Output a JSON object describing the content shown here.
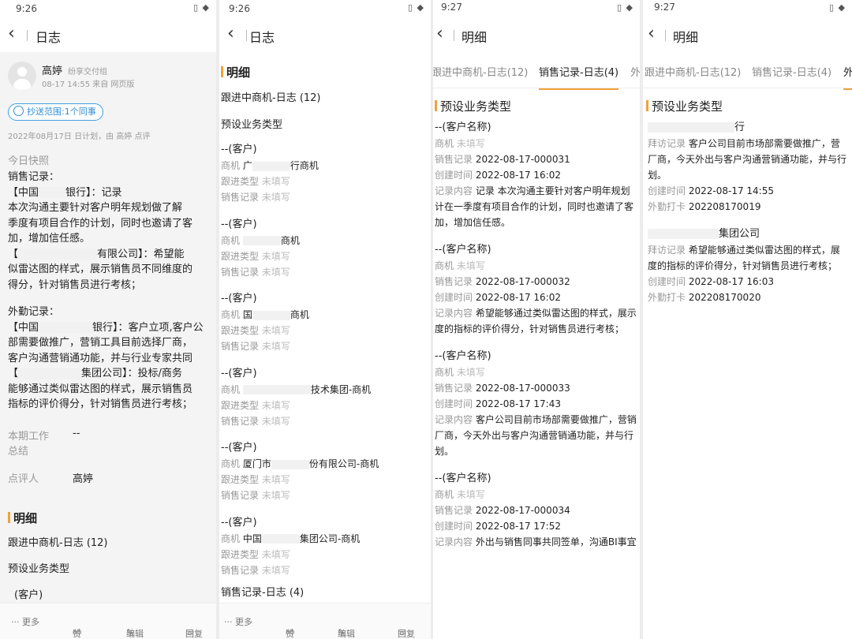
{
  "status": {
    "p1": "9:26",
    "p2": "9:26",
    "p3": "9:27",
    "p4": "9:27"
  },
  "p1": {
    "nav_title": "日志",
    "author": "高婷",
    "dept": "纷享交付组",
    "meta": "08-17 14:55 来自 网页版",
    "cc_chip": "抄送范围:1个同事",
    "sub_meta": "2022年08月17日 日计划，由 高婷 点评",
    "today_label": "今日快照",
    "sales_header": "销售记录：",
    "sales_l1a": "【中国",
    "sales_l1b": "银行】：记录",
    "sales_l2": "本次沟通主要针对客户明年规划做了解",
    "sales_l3": "季度有项目合作的计划，同时也邀请了客",
    "sales_l4": "加，增加信任感。",
    "sales_l5a": "【",
    "sales_l5b": "有限公司】：希望能",
    "sales_l6": "似雷达图的样式，展示销售员不同维度的",
    "sales_l7": "得分，针对销售员进行考核；",
    "field_header": "外勤记录：",
    "field_l1a": "【中国",
    "field_l1b": "银行】：客户立项,客户公",
    "field_l2": "部需要做推广，营销工具目前选择厂商，",
    "field_l3": "客户沟通营销通功能，并与行业专家共同",
    "field_l4a": "【",
    "field_l4b": "集团公司】：投标/商务",
    "field_l5": "能够通过类似雷达图的样式，展示销售员",
    "field_l6": "指标的评价得分，针对销售员进行考核；",
    "period_label": "本期工作",
    "period_label2": "总结",
    "period_value": "--",
    "reviewer_label": "点评人",
    "reviewer_value": "高婷",
    "detail_title": "明细",
    "follow_line": "跟进中商机-日志 (12)",
    "biz_type": "预设业务类型",
    "client_stub": "(客户)",
    "actions": {
      "more": "··· 更多",
      "like": "赞",
      "edit": "编辑",
      "reply": "回复"
    }
  },
  "p2": {
    "nav_title": "日志",
    "detail_title": "明细",
    "follow_line": "跟进中商机-日志 (12)",
    "biz_type": "预设业务类型",
    "client_label": "--(客户)",
    "opp_label": "商机",
    "follow_type_label": "跟进类型",
    "sales_rec_label": "销售记录",
    "not_filled": "未填写",
    "records": [
      {
        "opp_a": "广",
        "opp_b": "行商机"
      },
      {
        "opp_a": "",
        "opp_b": "商机"
      },
      {
        "opp_a": "国",
        "opp_b": "商机"
      },
      {
        "opp_a": "",
        "opp_b": "技术集团-商机"
      },
      {
        "opp_a": "厦门市",
        "opp_b": "份有限公司-商机"
      },
      {
        "opp_a": "中国",
        "opp_b": "集团公司-商机"
      }
    ],
    "bottom_line": "销售记录-日志 (4)",
    "actions": {
      "more": "··· 更多",
      "like": "赞",
      "edit": "编辑",
      "reply": "回复"
    }
  },
  "p3": {
    "nav_title": "明细",
    "tab1": "跟进中商机-日志(12)",
    "tab2": "销售记录-日志(4)",
    "tab3": "外",
    "biz_type": "预设业务类型",
    "client_label": "--(客户名称)",
    "opp_label": "商机",
    "not_filled": "未填写",
    "sales_rec_label": "销售记录",
    "created_label": "创建时间",
    "content_label": "记录内容",
    "records": [
      {
        "id": "2022-08-17-000031",
        "time": "2022-08-17 16:02",
        "c1": "记录 本次沟通主要针对客户明年规划",
        "c2": "计在一季度有项目合作的计划，同时也邀请了客",
        "c3": "加，增加信任感。"
      },
      {
        "id": "2022-08-17-000032",
        "time": "2022-08-17 16:02",
        "c1": "希望能够通过类似雷达图的样式，展示",
        "c2": "度的指标的评价得分，针对销售员进行考核；",
        "c3": ""
      },
      {
        "id": "2022-08-17-000033",
        "time": "2022-08-17 17:43",
        "c1": "客户公司目前市场部需要做推广，营销",
        "c2": "厂商，今天外出与客户沟通营销通功能，并与行",
        "c3": "划。"
      },
      {
        "id": "2022-08-17-000034",
        "time": "2022-08-17 17:52",
        "c1": "外出与销售同事共同签单，沟通BI事宜",
        "c2": "",
        "c3": ""
      }
    ]
  },
  "p4": {
    "nav_title": "明细",
    "tab1": "跟进中商机-日志(12)",
    "tab2": "销售记录-日志(4)",
    "tab3": "外",
    "biz_type": "预设业务类型",
    "visit_label": "拜访记录",
    "created_label": "创建时间",
    "checkin_label": "外勤打卡",
    "records": [
      {
        "client": "行",
        "v1": "客户公司目前市场部需要做推广，营",
        "v2": "厂商，今天外出与客户沟通营销通功能，并与行",
        "v3": "划。",
        "time": "2022-08-17 14:55",
        "checkin": "202208170019"
      },
      {
        "client": "集团公司",
        "v1": "希望能够通过类似雷达图的样式，展",
        "v2": "度的指标的评价得分，针对销售员进行考核；",
        "v3": "",
        "time": "2022-08-17 16:03",
        "checkin": "202208170020"
      }
    ]
  },
  "colors": {
    "accent": "#f2a03a",
    "link": "#2f8fd6",
    "label_gray": "#999999"
  }
}
